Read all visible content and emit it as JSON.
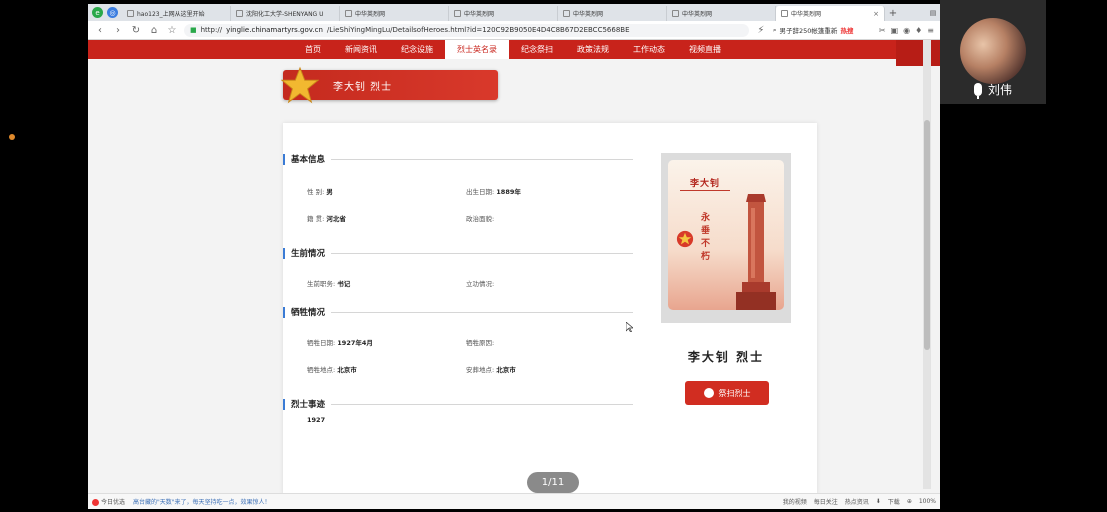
{
  "browser": {
    "tabs": [
      {
        "label": "hao123_上网从这里开始",
        "active": false
      },
      {
        "label": "沈阳化工大学-SHENYANG U",
        "active": false
      },
      {
        "label": "中华英烈网",
        "active": false
      },
      {
        "label": "中华英烈网",
        "active": false
      },
      {
        "label": "中华英烈网",
        "active": false
      },
      {
        "label": "中华英烈网",
        "active": false
      },
      {
        "label": "中华英烈网",
        "active": true
      }
    ],
    "url_prefix": "http://",
    "url_host": "yinglie.chinamartyrs.gov.cn",
    "url_path": "/LieShiYingMingLu/DetailsofHeroes.html?id=120C92B9050E4D4C8B67D2EBCC5668BE",
    "search_text": "男子辞250帐篷重新",
    "search_hot": "热搜"
  },
  "site": {
    "nav": [
      "首页",
      "新闻资讯",
      "纪念设施",
      "烈士英名录",
      "纪念祭扫",
      "政策法规",
      "工作动态",
      "视频直播"
    ],
    "nav_active_index": 3,
    "banner_title": "李大钊  烈士",
    "sections": {
      "basic": {
        "title": "基本信息",
        "gender_label": "性    别:",
        "gender_value": "男",
        "birth_label": "出生日期:",
        "birth_value": "1889年",
        "origin_label": "籍    贯:",
        "origin_value": "河北省",
        "politics_label": "政治面貌:"
      },
      "life": {
        "title": "生前情况",
        "position_label": "生前职务:",
        "position_value": "书记",
        "merit_label": "立功情况:"
      },
      "sacrifice": {
        "title": "牺牲情况",
        "date_label": "牺牲日期:",
        "date_value": "1927年4月",
        "reason_label": "牺牲原因:",
        "place_label": "牺牲地点:",
        "place_value": "北京市",
        "burial_label": "安葬地点:",
        "burial_value": "北京市"
      },
      "deeds": {
        "title": "烈士事迹",
        "value": "1927"
      }
    },
    "photo": {
      "name": "李大钊",
      "vertical_text": "永垂不朽"
    },
    "big_name": "李大钊  烈士",
    "mourn_button": "祭扫烈士",
    "pager": "1/11"
  },
  "statusbar": {
    "left": "今日优选",
    "news": "高台藏的\"天数\"来了，每天坚持吃一点，效果惊人！",
    "items": [
      "我的视频",
      "每日关注",
      "热点资讯"
    ],
    "download": "下载",
    "zoom": "100%"
  },
  "video": {
    "participant_name": "刘伟"
  },
  "colors": {
    "site_red": "#c8231b",
    "section_bar": "#3a7bd5"
  }
}
